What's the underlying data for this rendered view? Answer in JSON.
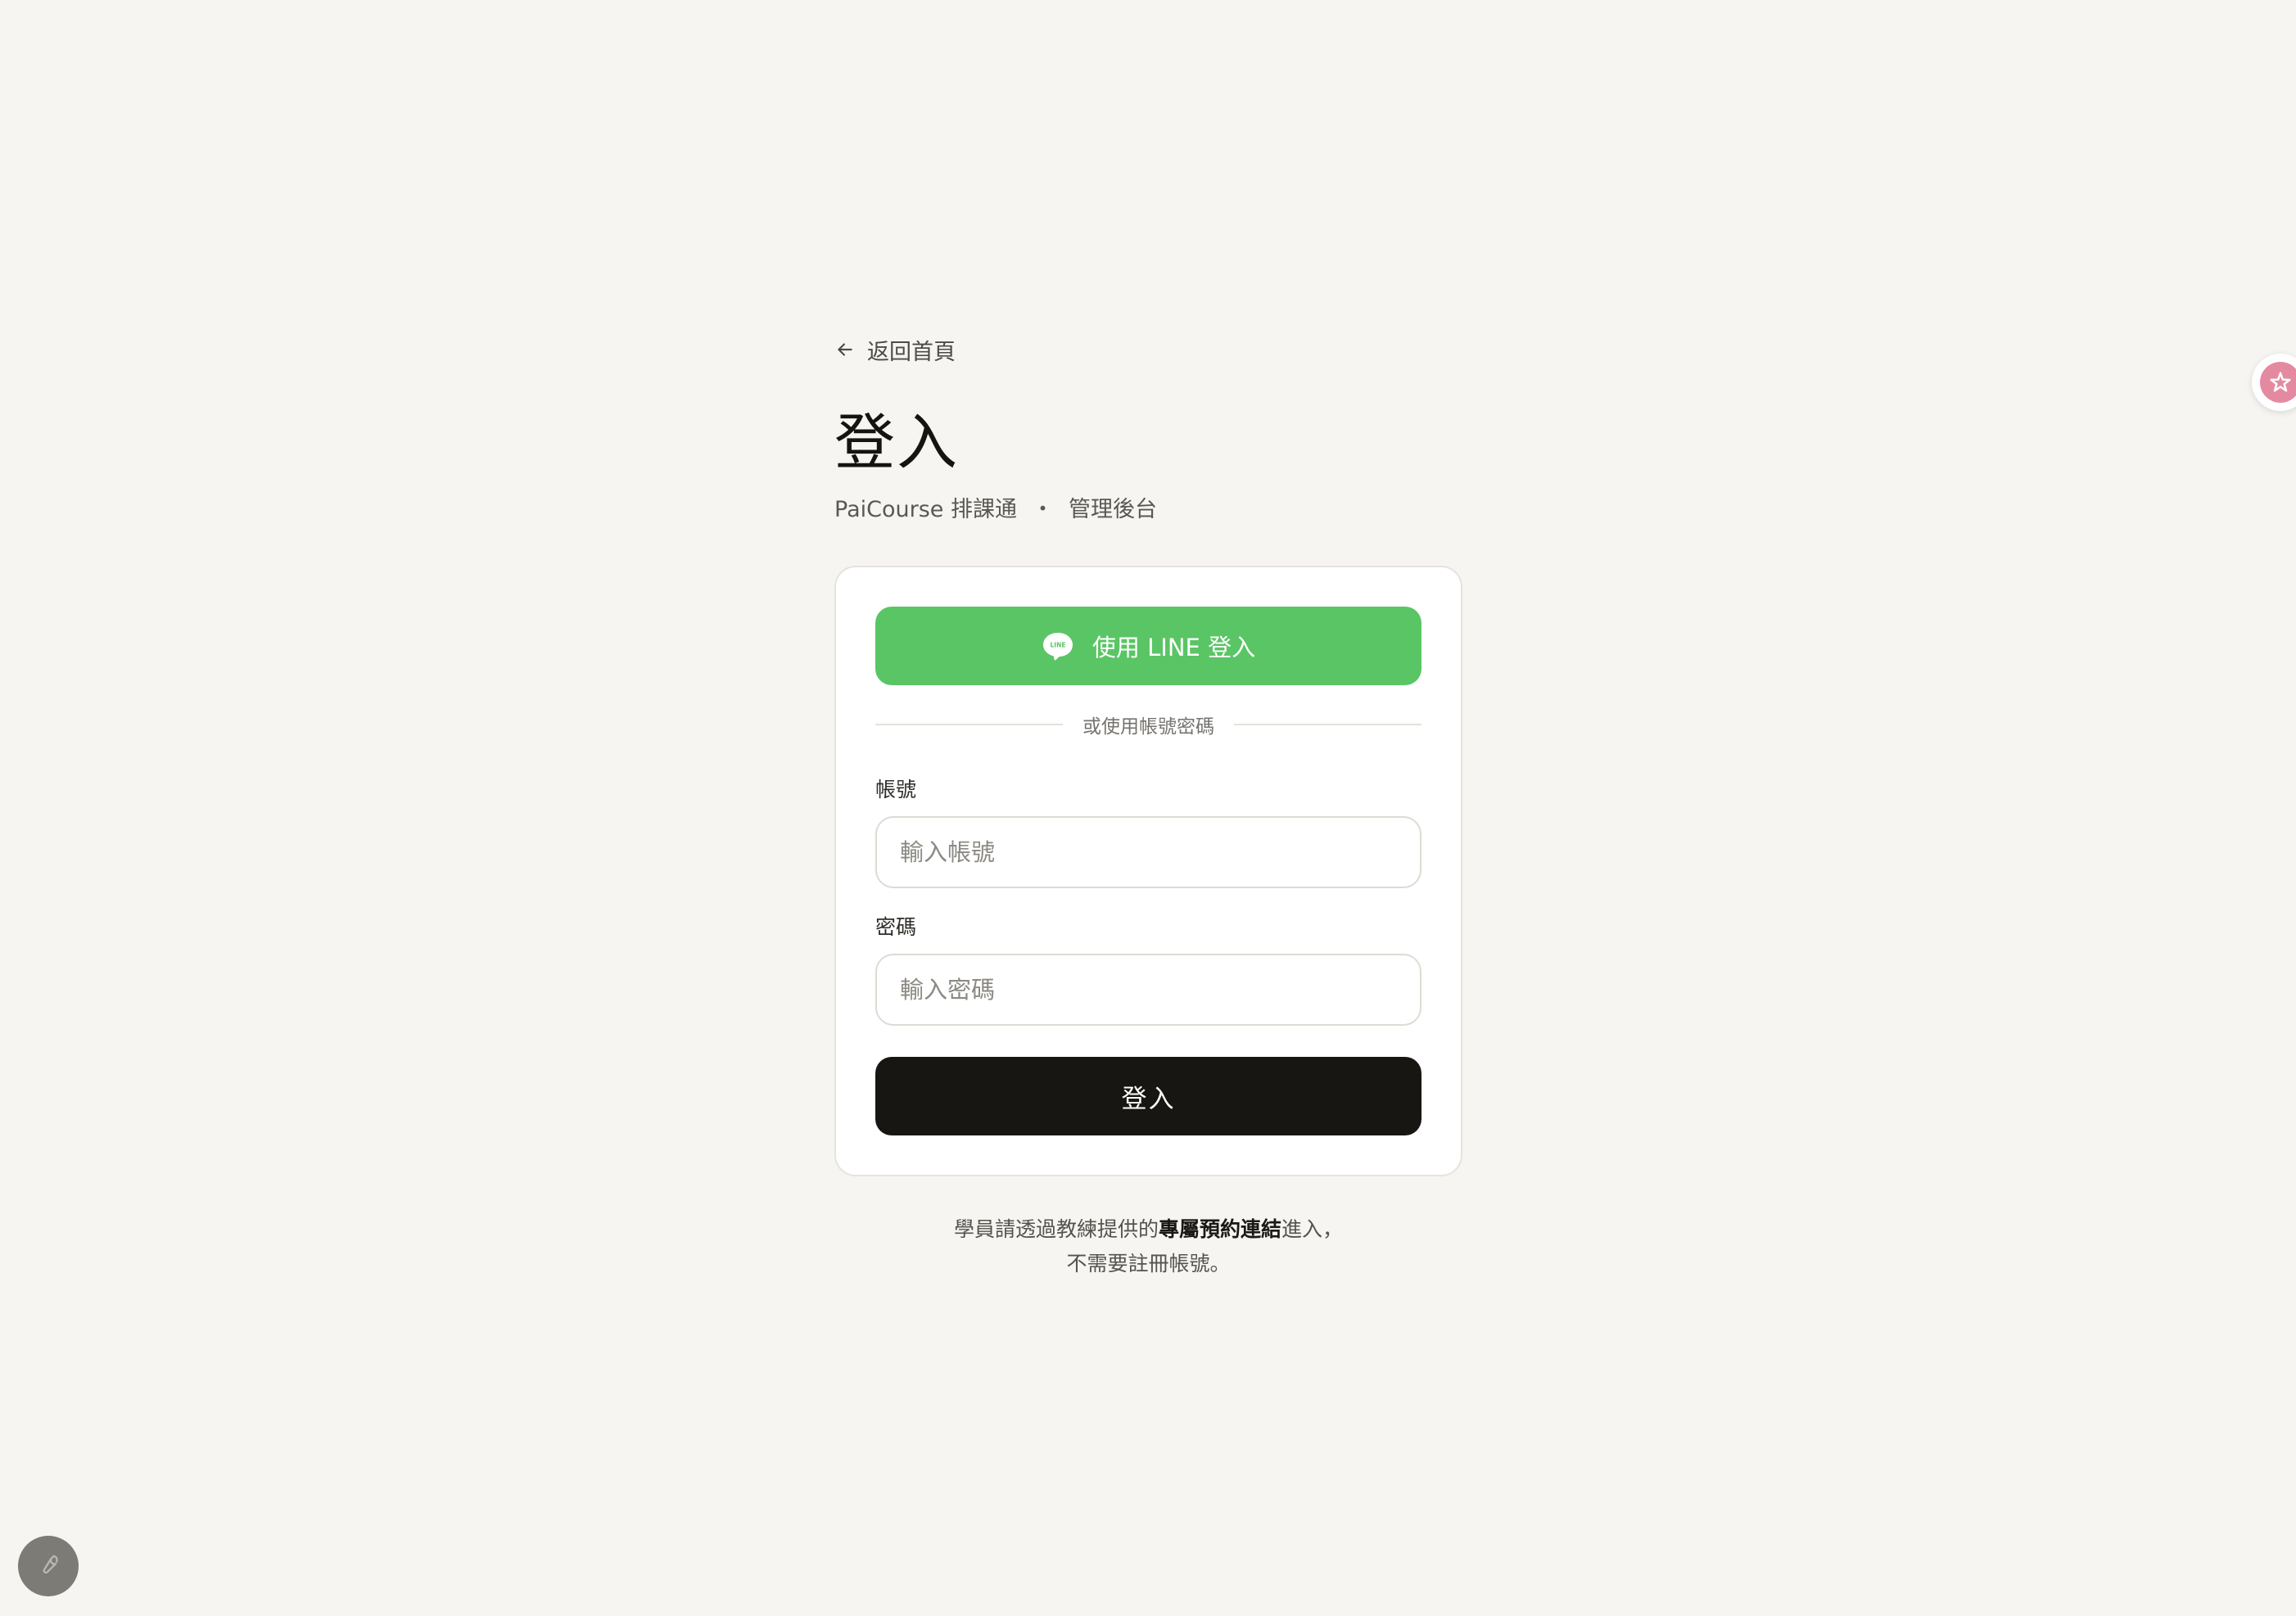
{
  "nav": {
    "back_label": "返回首頁"
  },
  "header": {
    "title": "登入",
    "subtitle_app": "PaiCourse 排課通",
    "subtitle_separator": "・",
    "subtitle_section": "管理後台"
  },
  "login_card": {
    "line_button_label": "使用 LINE 登入",
    "line_icon_text": "LINE",
    "divider_text": "或使用帳號密碼",
    "account": {
      "label": "帳號",
      "placeholder": "輸入帳號",
      "value": ""
    },
    "password": {
      "label": "密碼",
      "placeholder": "輸入密碼",
      "value": ""
    },
    "submit_label": "登入"
  },
  "footnote": {
    "line1_prefix": "學員請透過教練提供的",
    "line1_emphasis": "專屬預約連結",
    "line1_suffix": "進入，",
    "line2": "不需要註冊帳號。"
  },
  "icons": {
    "back": "arrow-left-icon",
    "line": "line-chat-bubble-icon",
    "side_widget": "sparkle-icon",
    "tool": "wrench-icon"
  },
  "colors": {
    "background": "#f6f5f1",
    "line_green": "#5ac565",
    "primary_dark": "#171612",
    "card_border": "#e6e3dc",
    "widget_pink": "#e48aa0",
    "tool_gray": "#7d7b75"
  }
}
